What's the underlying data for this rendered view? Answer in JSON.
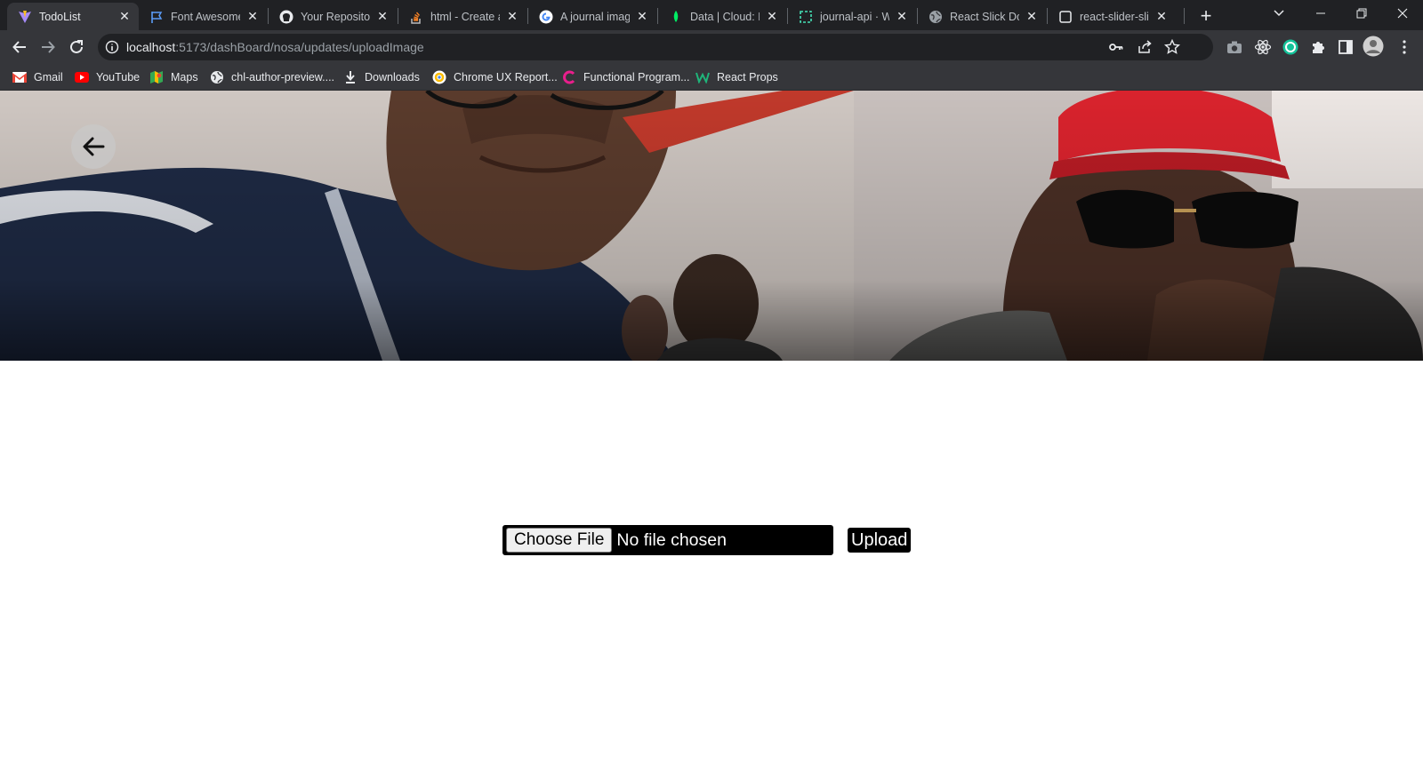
{
  "browser": {
    "tabs": [
      {
        "title": "TodoList",
        "icon": "vite-icon",
        "active": true
      },
      {
        "title": "Font Awesome",
        "icon": "flag-icon"
      },
      {
        "title": "Your Repositori",
        "icon": "github-icon"
      },
      {
        "title": "html - Create a",
        "icon": "stackoverflow-icon"
      },
      {
        "title": "A journal image",
        "icon": "google-icon"
      },
      {
        "title": "Data | Cloud: M",
        "icon": "mongodb-leaf-icon"
      },
      {
        "title": "journal-api · W",
        "icon": "render-icon"
      },
      {
        "title": "React Slick Doc",
        "icon": "globe-icon"
      },
      {
        "title": "react-slider-slic",
        "icon": "blank-page-icon"
      }
    ],
    "address": {
      "host": "localhost",
      "path": ":5173/dashBoard/nosa/updates/uploadImage"
    },
    "bookmarks": [
      {
        "label": "Gmail",
        "icon": "gmail-icon"
      },
      {
        "label": "YouTube",
        "icon": "youtube-icon"
      },
      {
        "label": "Maps",
        "icon": "maps-icon"
      },
      {
        "label": "chl-author-preview....",
        "icon": "globe-icon"
      },
      {
        "label": "Downloads",
        "icon": "download-icon"
      },
      {
        "label": "Chrome UX Report...",
        "icon": "chrome-ux-icon"
      },
      {
        "label": "Functional Program...",
        "icon": "functional-icon"
      },
      {
        "label": "React Props",
        "icon": "react-props-icon"
      }
    ]
  },
  "page": {
    "file_input": {
      "button_label": "Choose File",
      "status": "No file chosen"
    },
    "upload_label": "Upload"
  },
  "colors": {
    "chrome_dark": "#202124",
    "chrome_toolbar": "#35363a",
    "page_bg": "#ffffff",
    "button_black": "#000000"
  }
}
